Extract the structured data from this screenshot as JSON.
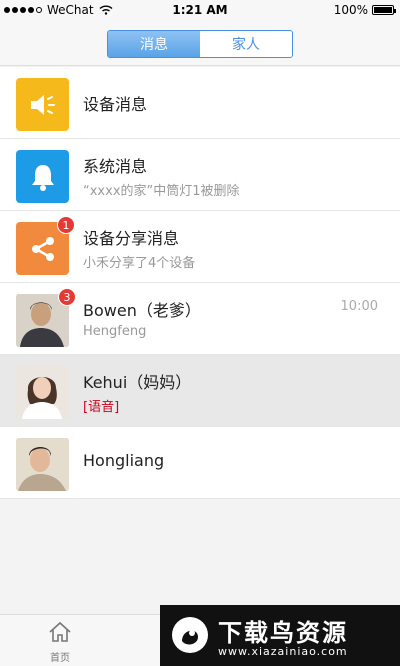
{
  "status_bar": {
    "carrier": "WeChat",
    "time": "1:21 AM",
    "battery": "100%"
  },
  "header": {
    "tabs": [
      {
        "label": "消息",
        "active": true
      },
      {
        "label": "家人",
        "active": false
      }
    ]
  },
  "messages": [
    {
      "title": "设备消息",
      "subtitle": "",
      "icon": "speaker-icon",
      "color": "#f6b91b"
    },
    {
      "title": "系统消息",
      "subtitle": "“xxxx的家”中筒灯1被删除",
      "icon": "bell-icon",
      "color": "#1e9be6"
    },
    {
      "title": "设备分享消息",
      "subtitle": "小禾分享了4个设备",
      "icon": "share-icon",
      "color": "#f28a3d",
      "badge": "1"
    },
    {
      "title": "Bowen（老爹）",
      "subtitle": "Hengfeng",
      "time": "10:00",
      "badge": "3"
    },
    {
      "title": "Kehui（妈妈）",
      "subtitle": "[语音]"
    },
    {
      "title": "Hongliang",
      "subtitle": ""
    }
  ],
  "tabbar": {
    "home_label": "首页"
  },
  "watermark": {
    "title": "下载鸟资源",
    "url": "www.xiazainiao.com"
  },
  "colors": {
    "accent": "#4a90e2",
    "badge": "#e53935"
  }
}
